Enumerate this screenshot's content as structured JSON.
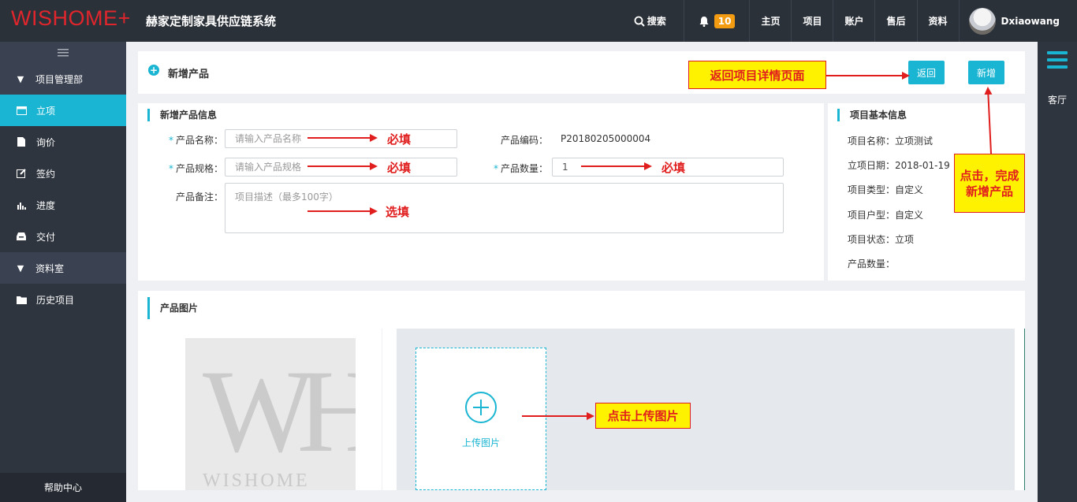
{
  "topbar": {
    "logo": "WISHOME+",
    "system_title": "赫家定制家具供应链系统",
    "search": "搜索",
    "notifications": "10",
    "nav": [
      "主页",
      "项目",
      "账户",
      "售后",
      "资料"
    ],
    "username": "Dxiaowang"
  },
  "sidebar": {
    "groups": [
      {
        "label": "项目管理部",
        "items": [
          "立项",
          "询价",
          "签约",
          "进度",
          "交付"
        ]
      },
      {
        "label": "资料室",
        "items": [
          "历史项目"
        ]
      }
    ],
    "help": "帮助中心"
  },
  "rightrail": {
    "label": "客厅"
  },
  "header": {
    "title": "新增产品",
    "back_label": "返回",
    "add_label": "新增"
  },
  "form": {
    "section_title": "新增产品信息",
    "name_label": "产品名称：",
    "name_placeholder": "请输入产品名称",
    "code_label": "产品编码：",
    "code_value": "P20180205000004",
    "spec_label": "产品规格：",
    "spec_placeholder": "请输入产品规格",
    "qty_label": "产品数量：",
    "qty_value": "1",
    "note_label": "产品备注：",
    "note_placeholder": "项目描述（最多100字）"
  },
  "basic": {
    "section_title": "项目基本信息",
    "lines": [
      "项目名称：立项测试",
      "立项日期：2018-01-19",
      "项目类型：自定义",
      "项目户型：自定义",
      "项目状态：立项",
      "产品数量："
    ]
  },
  "pictures": {
    "section_title": "产品图片",
    "upload_label": "上传图片",
    "sample_letters": "WH",
    "sample_word": "WISHOME"
  },
  "annotations": {
    "back_callout": "返回项目详情页面",
    "add_callout_line1": "点击，完成",
    "add_callout_line2": "新增产品",
    "required": "必填",
    "optional": "选填",
    "upload_callout": "点击上传图片"
  },
  "colors": {
    "accent": "#19b5d2",
    "dark": "#2b3139",
    "annotation_red": "#e01e1e",
    "annotation_yellow": "#fff200"
  }
}
